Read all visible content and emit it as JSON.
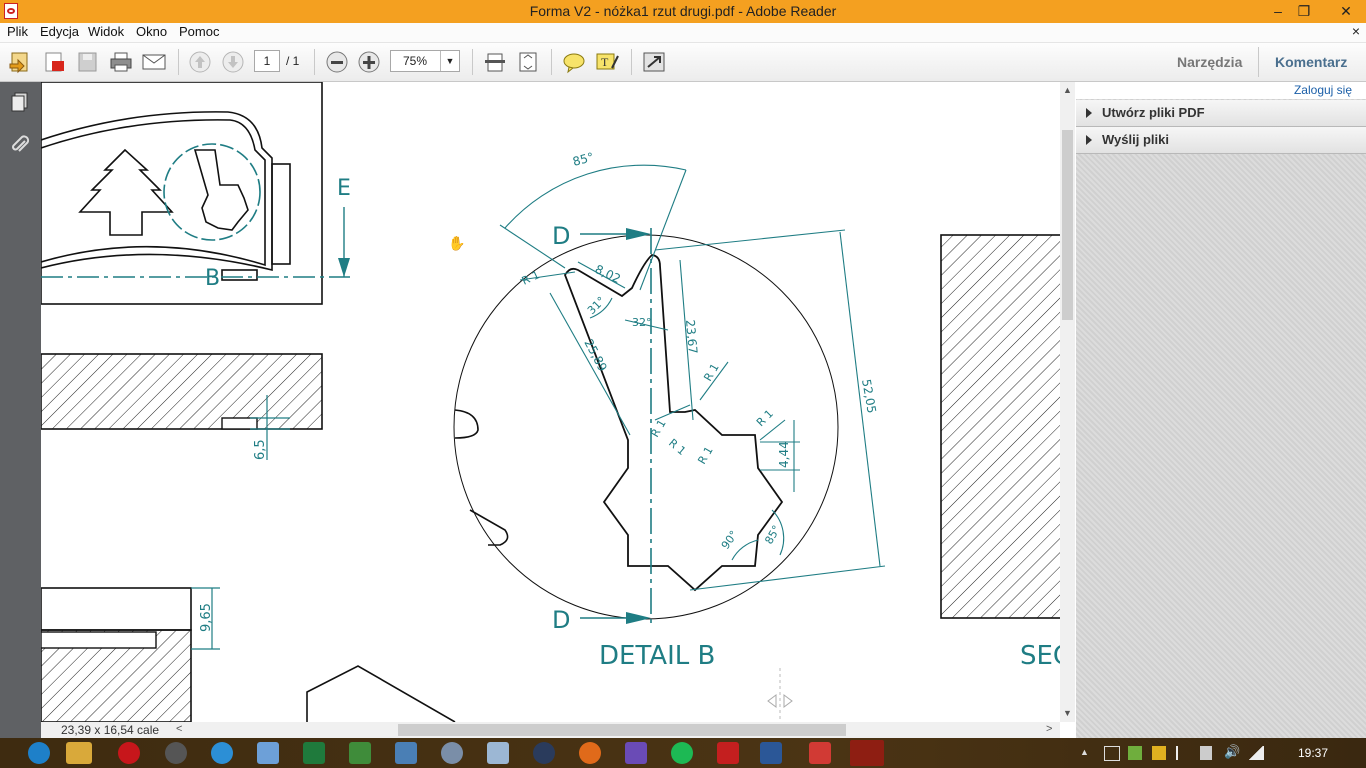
{
  "window": {
    "title": "Forma V2 - nóżka1 rzut drugi.pdf - Adobe Reader",
    "controls": [
      "–",
      "❐",
      "✕"
    ]
  },
  "menu": {
    "items": [
      "Plik",
      "Edycja",
      "Widok",
      "Okno",
      "Pomoc"
    ],
    "close_glyph": "×"
  },
  "toolbar": {
    "page_current": "1",
    "page_total": "/ 1",
    "zoom": "75%",
    "tools_label": "Narzędzia",
    "comment_label": "Komentarz"
  },
  "right_panel": {
    "login": "Zaloguj się",
    "items": [
      "Utwórz pliki PDF",
      "Wyślij pliki"
    ]
  },
  "status": {
    "page_size": "23,39 x 16,54 cale"
  },
  "drawing": {
    "label_e": "E",
    "label_b": "B",
    "dim_65": "6,5",
    "dim_965": "9,65",
    "label_d_top": "D",
    "label_d_bottom": "D",
    "detail_title": "DETAIL B",
    "section_label": "SEC",
    "angle_85_top": "85°",
    "dim_802": "8,02",
    "r1_a": "R 1",
    "angle_31": "31°",
    "angle_32": "32°",
    "dim_2367": "23,67",
    "dim_2589": "25,89",
    "r1_b": "R 1",
    "dim_5205": "52,05",
    "r1_c": "R 1",
    "r1_d": "R 1",
    "r1_e": "R 1",
    "r1_f": "R 1",
    "dim_444": "4,44",
    "angle_90": "90°",
    "angle_85_bottom": "85°"
  },
  "taskbar": {
    "time": "19:37"
  },
  "colors": {
    "title_bar": "#f4a020",
    "accent_link": "#1b5fa8",
    "drawing_dim": "#1f7d84"
  }
}
